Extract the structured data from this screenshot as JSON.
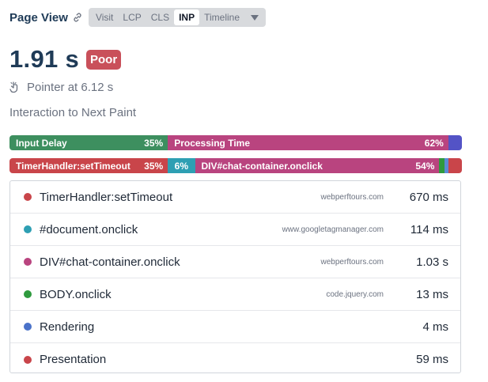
{
  "header": {
    "title": "Page View",
    "tabs": [
      {
        "label": "Visit",
        "active": false
      },
      {
        "label": "LCP",
        "active": false
      },
      {
        "label": "CLS",
        "active": false
      },
      {
        "label": "INP",
        "active": true
      },
      {
        "label": "Timeline",
        "active": false
      }
    ]
  },
  "metric": {
    "value": "1.91 s",
    "rating": "Poor"
  },
  "pointer": {
    "text": "Pointer at 6.12 s"
  },
  "subtitle": "Interaction to Next Paint",
  "phase_bar": [
    {
      "label": "Input Delay",
      "pct": "35%",
      "fraction": 0.35,
      "color": "#3d8f5f"
    },
    {
      "label": "Processing Time",
      "pct": "62%",
      "fraction": 0.62,
      "color": "#b9447f"
    },
    {
      "label": "",
      "pct": "",
      "fraction": 0.03,
      "color": "#5353c6"
    }
  ],
  "script_bar": [
    {
      "label": "TimerHandler:setTimeout",
      "pct": "35%",
      "fraction": 0.35,
      "color": "#c9454a"
    },
    {
      "label": "",
      "pct": "6%",
      "fraction": 0.06,
      "color": "#2e9fb3"
    },
    {
      "label": "DIV#chat-container.onclick",
      "pct": "54%",
      "fraction": 0.54,
      "color": "#b9447f"
    },
    {
      "label": "",
      "pct": "",
      "fraction": 0.012,
      "color": "#2f9a3e"
    },
    {
      "label": "",
      "pct": "",
      "fraction": 0.008,
      "color": "#5b8bd6"
    },
    {
      "label": "",
      "pct": "",
      "fraction": 0.03,
      "color": "#c9454a"
    }
  ],
  "rows": [
    {
      "name": "TimerHandler:setTimeout",
      "source": "webperftours.com",
      "value": "670 ms",
      "color": "#c9454a"
    },
    {
      "name": "#document.onclick",
      "source": "www.googletagmanager.com",
      "value": "114 ms",
      "color": "#2e9fb3"
    },
    {
      "name": "DIV#chat-container.onclick",
      "source": "webperftours.com",
      "value": "1.03 s",
      "color": "#b9447f"
    },
    {
      "name": "BODY.onclick",
      "source": "code.jquery.com",
      "value": "13 ms",
      "color": "#2f9a3e"
    },
    {
      "name": "Rendering",
      "source": "",
      "value": "4 ms",
      "color": "#4a72c9"
    },
    {
      "name": "Presentation",
      "source": "",
      "value": "59 ms",
      "color": "#c9454a"
    }
  ]
}
